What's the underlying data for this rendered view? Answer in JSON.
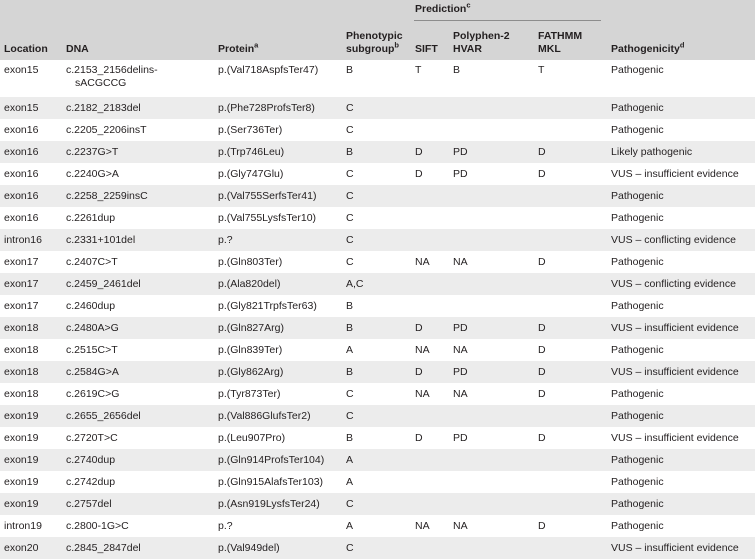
{
  "table": {
    "group_headers": {
      "prediction": "Prediction",
      "prediction_note": "c"
    },
    "columns": [
      {
        "key": "location",
        "label": "Location",
        "note": ""
      },
      {
        "key": "dna",
        "label": "DNA",
        "note": ""
      },
      {
        "key": "protein",
        "label": "Protein",
        "note": "a"
      },
      {
        "key": "subgroup_l1",
        "label": "Phenotypic",
        "label2": "subgroup",
        "note": "b"
      },
      {
        "key": "sift",
        "label": "SIFT",
        "note": ""
      },
      {
        "key": "polyphen_l1",
        "label": "Polyphen-2",
        "label2": "HVAR",
        "note": ""
      },
      {
        "key": "fathmm_l1",
        "label": "FATHMM",
        "label2": "MKL",
        "note": ""
      },
      {
        "key": "pathogenicity",
        "label": "Pathogenicity",
        "note": "d"
      }
    ],
    "rows": [
      {
        "location": "exon15",
        "dna": "c.2153_2156delins-",
        "dna_cont": "sACGCCG",
        "protein": "p.(Val718AspfsTer47)",
        "subgroup": "B",
        "sift": "T",
        "polyphen": "B",
        "fathmm": "T",
        "pathogenicity": "Pathogenic"
      },
      {
        "location": "exon15",
        "dna": "c.2182_2183del",
        "protein": "p.(Phe728ProfsTer8)",
        "subgroup": "C",
        "sift": "",
        "polyphen": "",
        "fathmm": "",
        "pathogenicity": "Pathogenic"
      },
      {
        "location": "exon16",
        "dna": "c.2205_2206insT",
        "protein": "p.(Ser736Ter)",
        "subgroup": "C",
        "sift": "",
        "polyphen": "",
        "fathmm": "",
        "pathogenicity": "Pathogenic"
      },
      {
        "location": "exon16",
        "dna": "c.2237G>T",
        "protein": "p.(Trp746Leu)",
        "subgroup": "B",
        "sift": "D",
        "polyphen": "PD",
        "fathmm": "D",
        "pathogenicity": "Likely pathogenic"
      },
      {
        "location": "exon16",
        "dna": "c.2240G>A",
        "protein": "p.(Gly747Glu)",
        "subgroup": "C",
        "sift": "D",
        "polyphen": "PD",
        "fathmm": "D",
        "pathogenicity": "VUS – insufficient evidence"
      },
      {
        "location": "exon16",
        "dna": "c.2258_2259insC",
        "protein": "p.(Val755SerfsTer41)",
        "subgroup": "C",
        "sift": "",
        "polyphen": "",
        "fathmm": "",
        "pathogenicity": "Pathogenic"
      },
      {
        "location": "exon16",
        "dna": "c.2261dup",
        "protein": "p.(Val755LysfsTer10)",
        "subgroup": "C",
        "sift": "",
        "polyphen": "",
        "fathmm": "",
        "pathogenicity": "Pathogenic"
      },
      {
        "location": "intron16",
        "dna": "c.2331+101del",
        "protein": "p.?",
        "subgroup": "C",
        "sift": "",
        "polyphen": "",
        "fathmm": "",
        "pathogenicity": "VUS – conflicting evidence"
      },
      {
        "location": "exon17",
        "dna": "c.2407C>T",
        "protein": "p.(Gln803Ter)",
        "subgroup": "C",
        "sift": "NA",
        "polyphen": "NA",
        "fathmm": "D",
        "pathogenicity": "Pathogenic"
      },
      {
        "location": "exon17",
        "dna": "c.2459_2461del",
        "protein": "p.(Ala820del)",
        "subgroup": "A,C",
        "sift": "",
        "polyphen": "",
        "fathmm": "",
        "pathogenicity": "VUS – conflicting evidence"
      },
      {
        "location": "exon17",
        "dna": "c.2460dup",
        "protein": "p.(Gly821TrpfsTer63)",
        "subgroup": "B",
        "sift": "",
        "polyphen": "",
        "fathmm": "",
        "pathogenicity": "Pathogenic"
      },
      {
        "location": "exon18",
        "dna": "c.2480A>G",
        "protein": "p.(Gln827Arg)",
        "subgroup": "B",
        "sift": "D",
        "polyphen": "PD",
        "fathmm": "D",
        "pathogenicity": "VUS – insufficient evidence"
      },
      {
        "location": "exon18",
        "dna": "c.2515C>T",
        "protein": "p.(Gln839Ter)",
        "subgroup": "A",
        "sift": "NA",
        "polyphen": "NA",
        "fathmm": "D",
        "pathogenicity": "Pathogenic"
      },
      {
        "location": "exon18",
        "dna": "c.2584G>A",
        "protein": "p.(Gly862Arg)",
        "subgroup": "B",
        "sift": "D",
        "polyphen": "PD",
        "fathmm": "D",
        "pathogenicity": "VUS – insufficient evidence"
      },
      {
        "location": "exon18",
        "dna": "c.2619C>G",
        "protein": "p.(Tyr873Ter)",
        "subgroup": "C",
        "sift": "NA",
        "polyphen": "NA",
        "fathmm": "D",
        "pathogenicity": "Pathogenic"
      },
      {
        "location": "exon19",
        "dna": "c.2655_2656del",
        "protein": "p.(Val886GlufsTer2)",
        "subgroup": "C",
        "sift": "",
        "polyphen": "",
        "fathmm": "",
        "pathogenicity": "Pathogenic"
      },
      {
        "location": "exon19",
        "dna": "c.2720T>C",
        "protein": "p.(Leu907Pro)",
        "subgroup": "B",
        "sift": "D",
        "polyphen": "PD",
        "fathmm": "D",
        "pathogenicity": "VUS – insufficient evidence"
      },
      {
        "location": "exon19",
        "dna": "c.2740dup",
        "protein": "p.(Gln914ProfsTer104)",
        "subgroup": "A",
        "sift": "",
        "polyphen": "",
        "fathmm": "",
        "pathogenicity": "Pathogenic"
      },
      {
        "location": "exon19",
        "dna": "c.2742dup",
        "protein": "p.(Gln915AlafsTer103)",
        "subgroup": "A",
        "sift": "",
        "polyphen": "",
        "fathmm": "",
        "pathogenicity": "Pathogenic"
      },
      {
        "location": "exon19",
        "dna": "c.2757del",
        "protein": "p.(Asn919LysfsTer24)",
        "subgroup": "C",
        "sift": "",
        "polyphen": "",
        "fathmm": "",
        "pathogenicity": "Pathogenic"
      },
      {
        "location": "intron19",
        "dna": "c.2800-1G>C",
        "protein": "p.?",
        "subgroup": "A",
        "sift": "NA",
        "polyphen": "NA",
        "fathmm": "D",
        "pathogenicity": "Pathogenic"
      },
      {
        "location": "exon20",
        "dna": "c.2845_2847del",
        "protein": "p.(Val949del)",
        "subgroup": "C",
        "sift": "",
        "polyphen": "",
        "fathmm": "",
        "pathogenicity": "VUS – insufficient evidence"
      }
    ]
  },
  "colors": {
    "header_bg": "#d5d5d5",
    "stripe_bg": "#ececec",
    "row_bg": "#ffffff",
    "text": "#231f20",
    "rule": "#8d8d8d"
  }
}
